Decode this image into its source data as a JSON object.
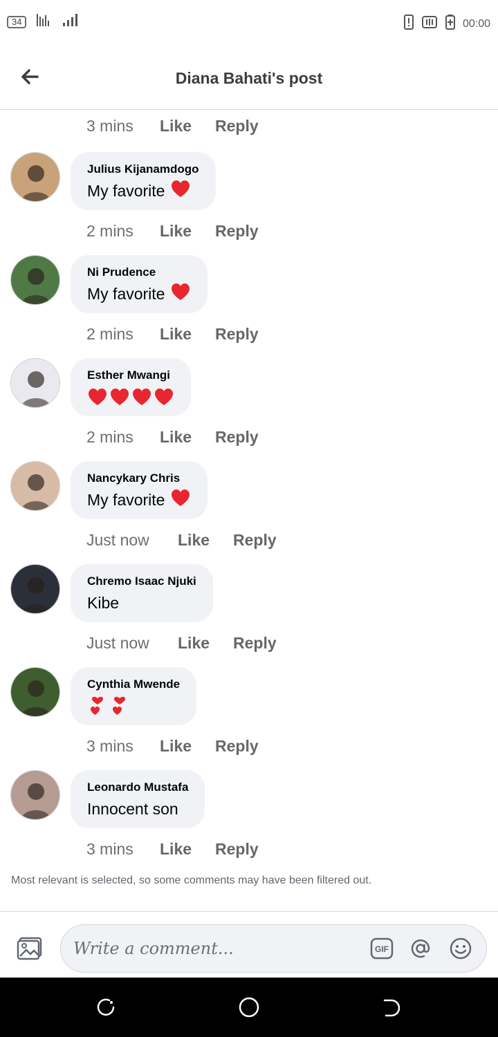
{
  "status_bar": {
    "badge": "34",
    "time": "00:00"
  },
  "header": {
    "title": "Diana  Bahati's post"
  },
  "first_meta": {
    "time": "3 mins",
    "like": "Like",
    "reply": "Reply"
  },
  "comments": [
    {
      "author": "Julius Kijanamdogo",
      "text": "My favorite",
      "emoji": "heart",
      "time": "2 mins",
      "like": "Like",
      "reply": "Reply",
      "avatar_color": "#c9a27a"
    },
    {
      "author": "Ni Prudence",
      "text": "My favorite",
      "emoji": "heart",
      "time": "2 mins",
      "like": "Like",
      "reply": "Reply",
      "avatar_color": "#4f7a46"
    },
    {
      "author": "Esther Mwangi",
      "text": "",
      "emoji": "four-hearts",
      "time": "2 mins",
      "like": "Like",
      "reply": "Reply",
      "avatar_color": "#e9e9ef"
    },
    {
      "author": "Nancykary Chris",
      "text": "My favorite",
      "emoji": "heart",
      "time": "Just now",
      "like": "Like",
      "reply": "Reply",
      "avatar_color": "#d8bba6"
    },
    {
      "author": "Chremo Isaac Njuki",
      "text": "Kibe",
      "emoji": "",
      "time": "Just now",
      "like": "Like",
      "reply": "Reply",
      "avatar_color": "#2a2f3a"
    },
    {
      "author": "Cynthia Mwende",
      "text": "",
      "emoji": "two-heart-exclamation",
      "time": "3 mins",
      "like": "Like",
      "reply": "Reply",
      "avatar_color": "#3f5e2f"
    },
    {
      "author": "Leonardo Mustafa",
      "text": "Innocent son",
      "emoji": "",
      "time": "3 mins",
      "like": "Like",
      "reply": "Reply",
      "avatar_color": "#b59b92"
    }
  ],
  "notice": "Most relevant is selected, so some comments may have been filtered out.",
  "composer": {
    "placeholder": "Write a comment...",
    "gif_label": "GIF",
    "icons": [
      "photo-icon",
      "gif-icon",
      "mention-icon",
      "emoji-icon"
    ]
  },
  "navbar": {
    "icons": [
      "recents-icon",
      "home-icon",
      "back-icon"
    ]
  },
  "colors": {
    "bubble": "#f0f2f5",
    "heart": "#e8262f",
    "muted_text": "#65676b"
  }
}
